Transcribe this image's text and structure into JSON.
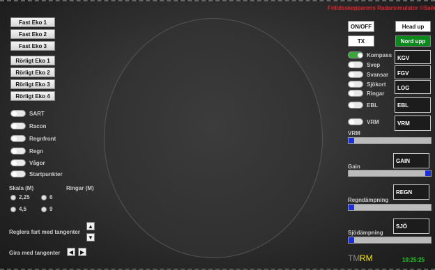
{
  "header": {
    "title": "Fritidsskepparens Radarsimulator ©Sailon",
    "title_color": "#e0262e"
  },
  "echo_buttons": {
    "fixed": [
      "Fast Eko 1",
      "Fast Eko 2",
      "Fast Eko 3"
    ],
    "moving": [
      "Rörligt Eko 1",
      "Rörligt Eko 2",
      "Rörligt Eko 3",
      "Rörligt Eko 4"
    ]
  },
  "left_toggles": [
    {
      "label": "SART",
      "on": false
    },
    {
      "label": "Racon",
      "on": false
    },
    {
      "label": "Regnfront",
      "on": false
    },
    {
      "label": "Regn",
      "on": false
    },
    {
      "label": "Vågor",
      "on": false
    },
    {
      "label": "Startpunkter",
      "on": false
    }
  ],
  "scale": {
    "label": "Skala (M)",
    "rings_label": "Ringar (M)",
    "options": [
      "2,25",
      "6",
      "4,5",
      "9"
    ]
  },
  "speed_control": {
    "label": "Reglera fart med tangenter",
    "up_icon": "▲",
    "down_icon": "▼"
  },
  "turn_control": {
    "label": "Gira med tangenter",
    "left_icon": "◀",
    "right_icon": "▶"
  },
  "top_buttons": {
    "onoff": "ON/OFF",
    "tx": "TX",
    "head_up": "Head up",
    "north_up": "Nord upp",
    "north_up_color": "#0a8a1a"
  },
  "right_toggles": [
    {
      "label": "Kompass",
      "on": true
    },
    {
      "label": "Svep",
      "on": false
    },
    {
      "label": "Svansar",
      "on": false
    },
    {
      "label": "Sjökort",
      "on": false
    },
    {
      "label": "Ringar",
      "on": false
    },
    {
      "label": "EBL",
      "on": false
    },
    {
      "label": "VRM",
      "on": false
    }
  ],
  "data_boxes": {
    "kgv": "KGV",
    "fgv": "FGV",
    "log": "LOG",
    "ebl": "EBL",
    "vrm": "VRM",
    "gain": "GAIN",
    "regn": "REGN",
    "sjo": "SJÖ"
  },
  "sliders": {
    "vrm": {
      "label": "VRM",
      "value": 0.0
    },
    "gain": {
      "label": "Gain",
      "value": 1.0
    },
    "regn": {
      "label": "Regndämpning",
      "value": 0.0
    },
    "sjo": {
      "label": "Sjödämpning",
      "value": 0.0
    }
  },
  "mode": {
    "tm": "TM",
    "rm": "RM",
    "rm_color": "#f5e400"
  },
  "clock": {
    "time": "10:25:25",
    "color": "#22d422"
  }
}
